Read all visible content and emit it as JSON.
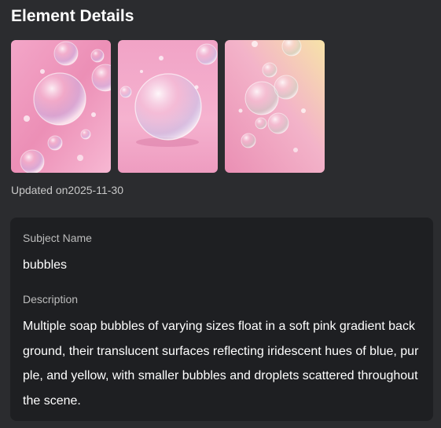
{
  "panel": {
    "title": "Element Details",
    "updated_label": "Updated on",
    "updated_date": "2025-11-30",
    "images": [
      {
        "icon": "bubbles-image-1"
      },
      {
        "icon": "bubbles-image-2"
      },
      {
        "icon": "bubbles-image-3"
      }
    ]
  },
  "details": {
    "subject_label": "Subject Name",
    "subject_value": "bubbles",
    "description_label": "Description",
    "description_value": "Multiple soap bubbles of varying sizes float in a soft pink gradient background, their translucent surfaces reflecting iridescent hues of blue, purple, and yellow, with smaller bubbles and droplets scattered throughout the scene."
  },
  "colors": {
    "background": "#2b2c2f",
    "card": "#1e1f22",
    "text_primary": "#ffffff",
    "text_secondary": "#bcbcbc"
  }
}
